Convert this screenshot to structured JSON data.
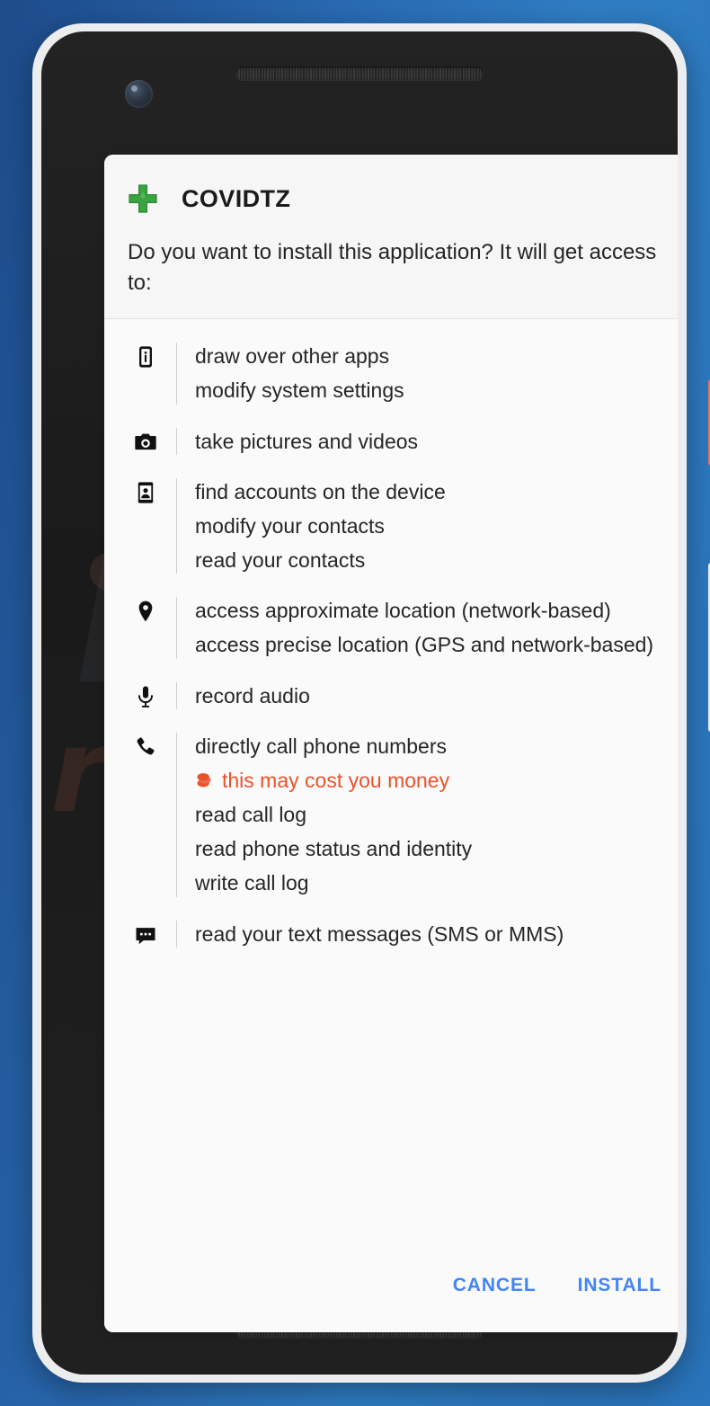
{
  "background": {
    "color_left": "#1d4b8a",
    "color_right": "#2a74bb"
  },
  "device": {
    "name": "android-phone-mockup",
    "frame_color": "#ecedee",
    "body_color": "#1f1f1f",
    "power_button_color": "#e8745a",
    "volume_button_color": "#e9eaea"
  },
  "watermark": {
    "brand": "PC",
    "domain": "risk.com"
  },
  "dialog": {
    "app_icon": "green-cross-icon",
    "app_name": "COVIDTZ",
    "question": "Do you want to install this application? It will get access to:",
    "permission_groups": [
      {
        "icon": "device-info-icon",
        "lines": [
          {
            "text": "draw over other apps",
            "warning": false
          },
          {
            "text": "modify system settings",
            "warning": false
          }
        ]
      },
      {
        "icon": "camera-icon",
        "lines": [
          {
            "text": "take pictures and videos",
            "warning": false
          }
        ]
      },
      {
        "icon": "contacts-icon",
        "lines": [
          {
            "text": "find accounts on the device",
            "warning": false
          },
          {
            "text": "modify your contacts",
            "warning": false
          },
          {
            "text": "read your contacts",
            "warning": false
          }
        ]
      },
      {
        "icon": "location-pin-icon",
        "lines": [
          {
            "text": "access approximate location (network-based)",
            "warning": false
          },
          {
            "text": "access precise location (GPS and network-based)",
            "warning": false
          }
        ]
      },
      {
        "icon": "microphone-icon",
        "lines": [
          {
            "text": "record audio",
            "warning": false
          }
        ]
      },
      {
        "icon": "phone-call-icon",
        "lines": [
          {
            "text": "directly call phone numbers",
            "warning": false
          },
          {
            "text": "this may cost you money",
            "warning": true
          },
          {
            "text": "read call log",
            "warning": false
          },
          {
            "text": "read phone status and identity",
            "warning": false
          },
          {
            "text": "write call log",
            "warning": false
          }
        ]
      },
      {
        "icon": "sms-message-icon",
        "lines": [
          {
            "text": "read your text messages (SMS or MMS)",
            "warning": false
          }
        ]
      }
    ],
    "actions": {
      "cancel_label": "CANCEL",
      "install_label": "INSTALL",
      "button_color": "#4285f4"
    },
    "warning_color": "#e8532b"
  }
}
